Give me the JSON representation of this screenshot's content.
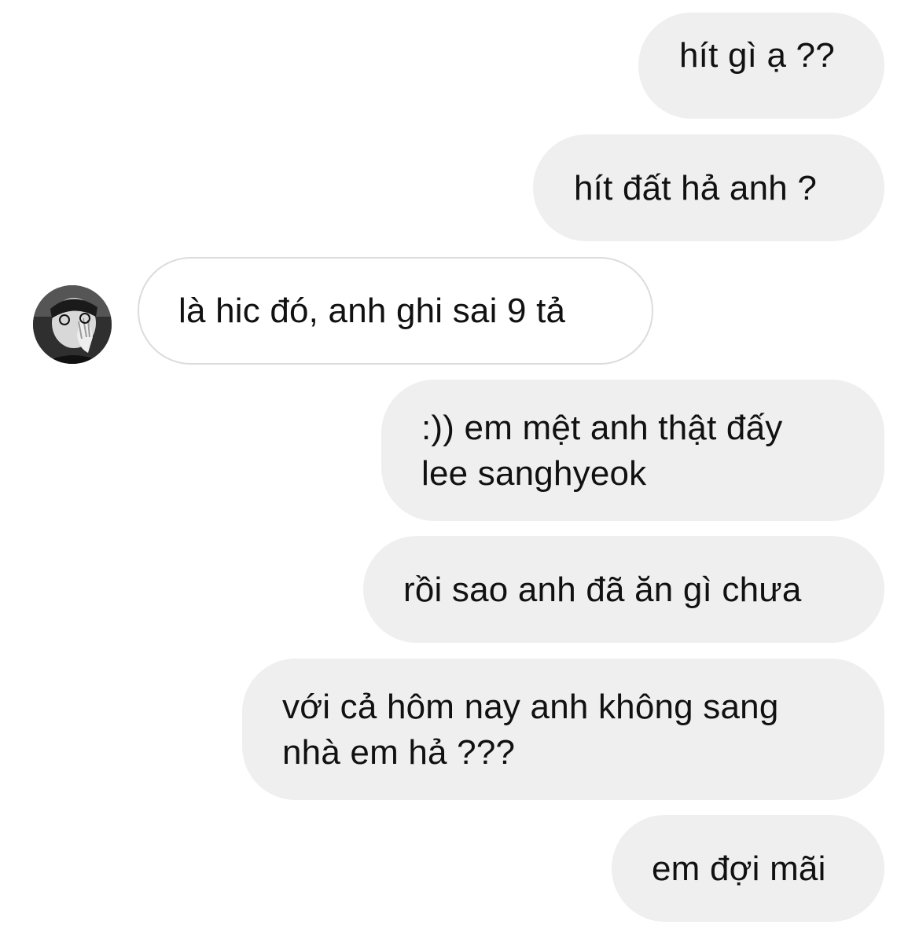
{
  "conversation": {
    "messages": [
      {
        "sender": "me",
        "text": "hít gì ạ ??"
      },
      {
        "sender": "me",
        "text": "hít đất hả anh ?"
      },
      {
        "sender": "them",
        "text": "là hic đó, anh ghi sai 9 tả",
        "avatar_icon": "user-avatar"
      },
      {
        "sender": "me",
        "text": ":)) em mệt anh thật đấy\nlee sanghyeok"
      },
      {
        "sender": "me",
        "text": "rồi sao anh đã ăn gì chưa"
      },
      {
        "sender": "me",
        "text": "với cả hôm nay anh không sang\nnhà em hả ???"
      },
      {
        "sender": "me",
        "text": "em đợi mãi"
      }
    ]
  },
  "colors": {
    "outgoing_bubble": "#efefef",
    "incoming_bubble": "#ffffff",
    "incoming_border": "#dcdcdc",
    "text": "#111111"
  }
}
